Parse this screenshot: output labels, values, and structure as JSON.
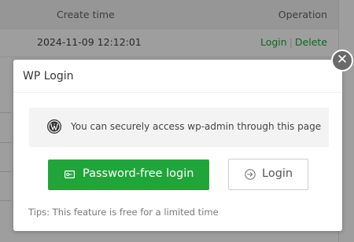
{
  "background_table": {
    "header": {
      "create_time_label": "Create time",
      "operation_label": "Operation"
    },
    "rows": [
      {
        "create_time": "2024-11-09 12:12:01",
        "ops": {
          "login": "Login",
          "separator": "|",
          "delete": "Delete"
        }
      }
    ]
  },
  "dialog": {
    "title": "WP Login",
    "close_icon": "close-icon",
    "info": {
      "icon": "wordpress-icon",
      "text": "You can securely access wp-admin through this page"
    },
    "buttons": {
      "password_free": {
        "label": "Password-free login",
        "icon": "key-card-icon"
      },
      "login": {
        "label": "Login",
        "icon": "arrow-right-circle-icon"
      }
    },
    "tips": "Tips: This feature is free for a limited time"
  },
  "colors": {
    "accent": "#20a53a",
    "overlay": "rgba(0,0,0,0.38)",
    "close_bg": "#6a6a6a"
  }
}
